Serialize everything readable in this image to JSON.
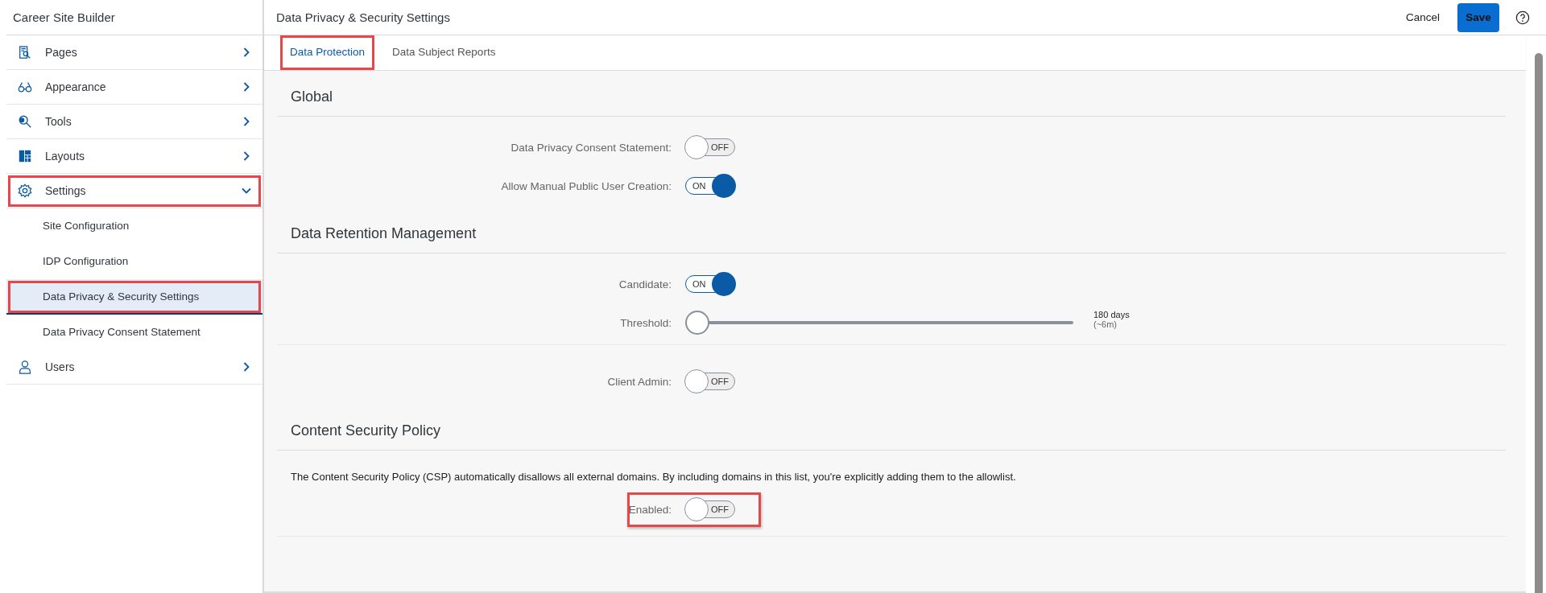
{
  "app_title": "Career Site Builder",
  "sidebar": {
    "items": [
      {
        "label": "Pages",
        "expanded": false,
        "highlighted": false
      },
      {
        "label": "Appearance",
        "expanded": false,
        "highlighted": false
      },
      {
        "label": "Tools",
        "expanded": false,
        "highlighted": false
      },
      {
        "label": "Layouts",
        "expanded": false,
        "highlighted": false
      },
      {
        "label": "Settings",
        "expanded": true,
        "highlighted": true,
        "children": [
          {
            "label": "Site Configuration",
            "selected": false,
            "highlighted": false
          },
          {
            "label": "IDP Configuration",
            "selected": false,
            "highlighted": false
          },
          {
            "label": "Data Privacy & Security Settings",
            "selected": true,
            "highlighted": true
          },
          {
            "label": "Data Privacy Consent Statement",
            "selected": false,
            "highlighted": false
          }
        ]
      },
      {
        "label": "Users",
        "expanded": false,
        "highlighted": false
      }
    ]
  },
  "header": {
    "title": "Data Privacy & Security Settings",
    "cancel": "Cancel",
    "save": "Save"
  },
  "tabs": [
    {
      "label": "Data Protection",
      "selected": true,
      "highlighted": true
    },
    {
      "label": "Data Subject Reports",
      "selected": false,
      "highlighted": false
    }
  ],
  "sections": [
    {
      "title": "Global",
      "blocks": [
        {
          "rows": [
            {
              "kind": "toggle",
              "label": "Data Privacy Consent Statement:",
              "on": false,
              "text": "OFF",
              "highlighted": false
            },
            {
              "kind": "toggle",
              "label": "Allow Manual Public User Creation:",
              "on": true,
              "text": "ON",
              "highlighted": false
            }
          ]
        }
      ]
    },
    {
      "title": "Data Retention Management",
      "blocks": [
        {
          "rows": [
            {
              "kind": "toggle",
              "label": "Candidate:",
              "on": true,
              "text": "ON",
              "highlighted": false
            },
            {
              "kind": "slider",
              "label": "Threshold:",
              "level": 0,
              "value": "180 days",
              "note": "(~6m)"
            }
          ]
        },
        {
          "rows": [
            {
              "kind": "toggle",
              "label": "Client Admin:",
              "on": false,
              "text": "OFF",
              "highlighted": false
            }
          ]
        }
      ]
    },
    {
      "title": "Content Security Policy",
      "description": "The Content Security Policy (CSP) automatically disallows all external domains. By including domains in this list, you're explicitly adding them to the allowlist.",
      "blocks": [
        {
          "rows": [
            {
              "kind": "toggle",
              "label": "Enabled:",
              "on": false,
              "text": "OFF",
              "highlighted": true
            }
          ]
        }
      ]
    }
  ]
}
